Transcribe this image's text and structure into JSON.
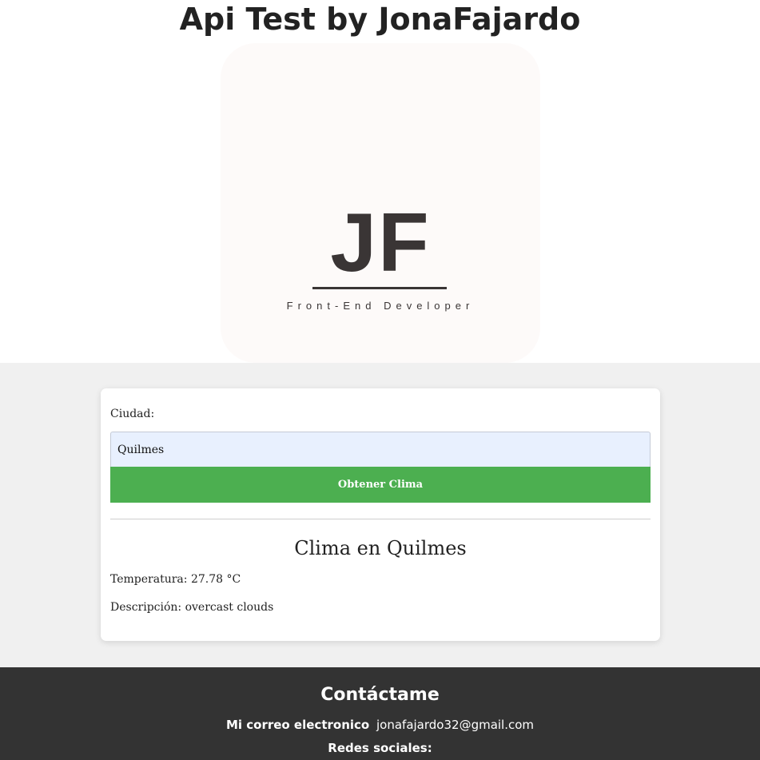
{
  "header": {
    "title": "Api Test by JonaFajardo"
  },
  "logo": {
    "mark": "JF",
    "subtitle": "Front-End Developer"
  },
  "form": {
    "city_label": "Ciudad:",
    "city_value": "Quilmes",
    "submit_label": "Obtener Clima"
  },
  "weather": {
    "title": "Clima en Quilmes",
    "temperature": "Temperatura: 27.78 °C",
    "description": "Descripción: overcast clouds"
  },
  "footer": {
    "title": "Contáctame",
    "email_label": "Mi correo electronico",
    "email_value": "jonafajardo32@gmail.com",
    "social_label": "Redes sociales:"
  },
  "colors": {
    "button": "#4caf50",
    "footer_bg": "#333333",
    "input_bg": "#e8f0fe"
  }
}
